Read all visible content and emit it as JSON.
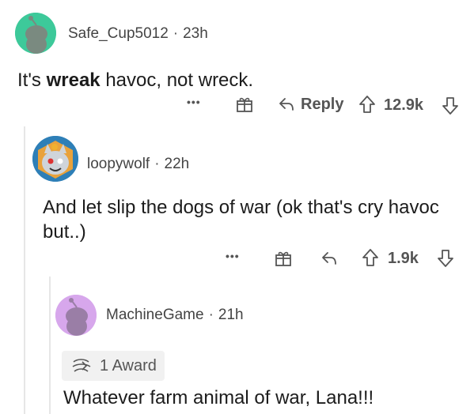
{
  "comments": [
    {
      "username": "Safe_Cup5012",
      "time": "23h",
      "body_pre": "It's ",
      "body_bold": "wreak",
      "body_post": " havoc, not wreck.",
      "reply_label": "Reply",
      "score": "12.9k",
      "more": "•••",
      "avatar_color": "#3dc99a"
    },
    {
      "username": "loopywolf",
      "time": "22h",
      "body": "And let slip the dogs of war (ok that's cry havoc but..)",
      "score": "1.9k",
      "more": "•••",
      "avatar_color": "#2e7fb7"
    },
    {
      "username": "MachineGame",
      "time": "21h",
      "award_label": "1 Award",
      "body": "Whatever farm animal of war, Lana!!!",
      "avatar_color": "#d7a7ec"
    }
  ],
  "separator": "·"
}
